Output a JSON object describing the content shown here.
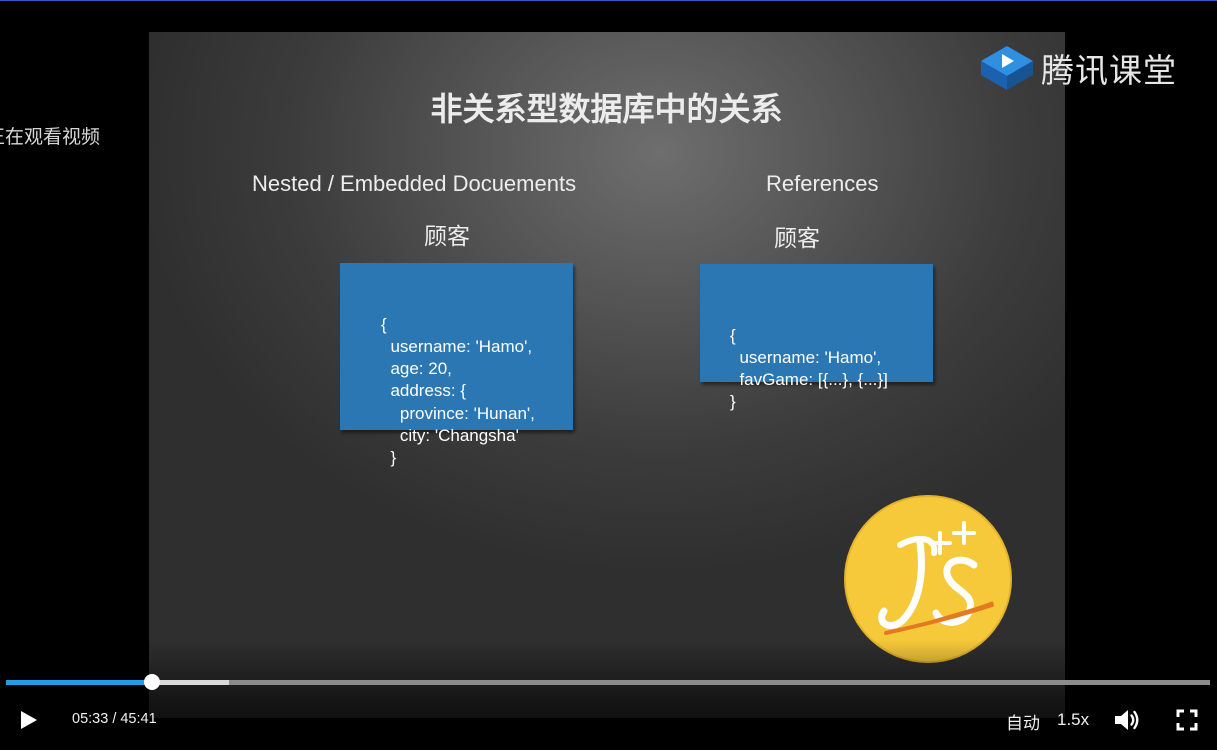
{
  "status": {
    "watching_text": "正在观看视频"
  },
  "brand": {
    "name": "腾讯课堂",
    "logo_icon": "tencent-classroom-play-logo"
  },
  "slide": {
    "title": "非关系型数据库中的关系",
    "left": {
      "heading": "Nested / Embedded Docuements",
      "subheading": "顾客",
      "code": "{\n  username: 'Hamo',\n  age: 20,\n  address: {\n    province: 'Hunan',\n    city: 'Changsha'\n  }"
    },
    "right": {
      "heading": "References",
      "subheading": "顾客",
      "code": "{\n  username: 'Hamo',\n  favGame: [{...}, {...}]\n}"
    },
    "code_box_color": "#2a77b3",
    "watermark_logo": "js-plus-plus-logo"
  },
  "player": {
    "current_time": "05:33",
    "total_time": "45:41",
    "time_display": "05:33 / 45:41",
    "played_fraction": 0.121,
    "buffered_fraction": 0.185,
    "quality_label": "自动",
    "speed_label": "1.5x",
    "progress_color": "#1e9fe5",
    "icons": [
      "play-icon",
      "volume-icon",
      "fullscreen-icon"
    ]
  }
}
